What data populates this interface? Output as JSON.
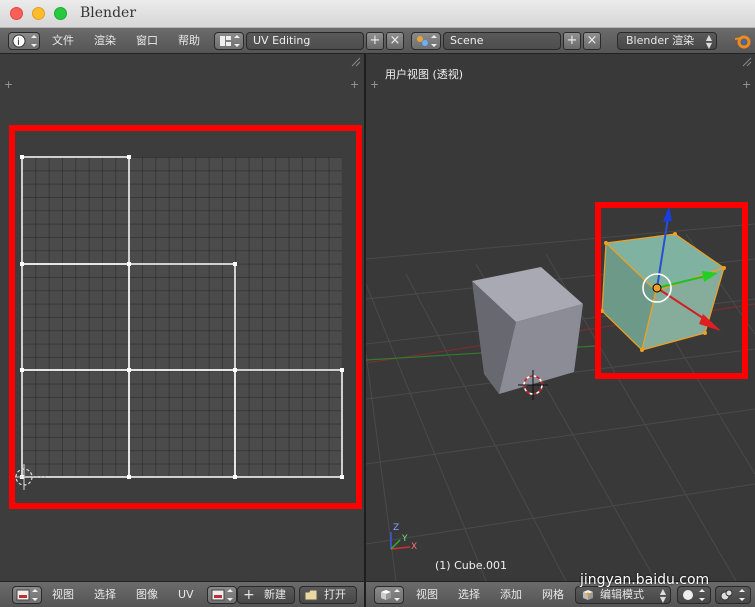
{
  "window": {
    "title": "Blender"
  },
  "topbar": {
    "menus": [
      "文件",
      "渲染",
      "窗口",
      "帮助"
    ],
    "screen_layout": "UV Editing",
    "scene": "Scene",
    "render_engine": "Blender 渲染"
  },
  "viewport": {
    "label": "用户视图 (透视)",
    "object_label": "(1) Cube.001",
    "axis_letters": [
      "Z",
      "X",
      "Y"
    ]
  },
  "uv_header": {
    "menus": [
      "视图",
      "选择",
      "图像",
      "UV"
    ],
    "new_button": "新建",
    "open_button": "打开"
  },
  "viewport_header": {
    "menus": [
      "视图",
      "选择",
      "添加",
      "网格"
    ],
    "mode": "编辑模式"
  },
  "watermark": "jingyan.baidu.com",
  "colors": {
    "highlight": "#ff0000",
    "accent_orange": "#f0a020",
    "panel_bg": "#3d3d3d"
  }
}
